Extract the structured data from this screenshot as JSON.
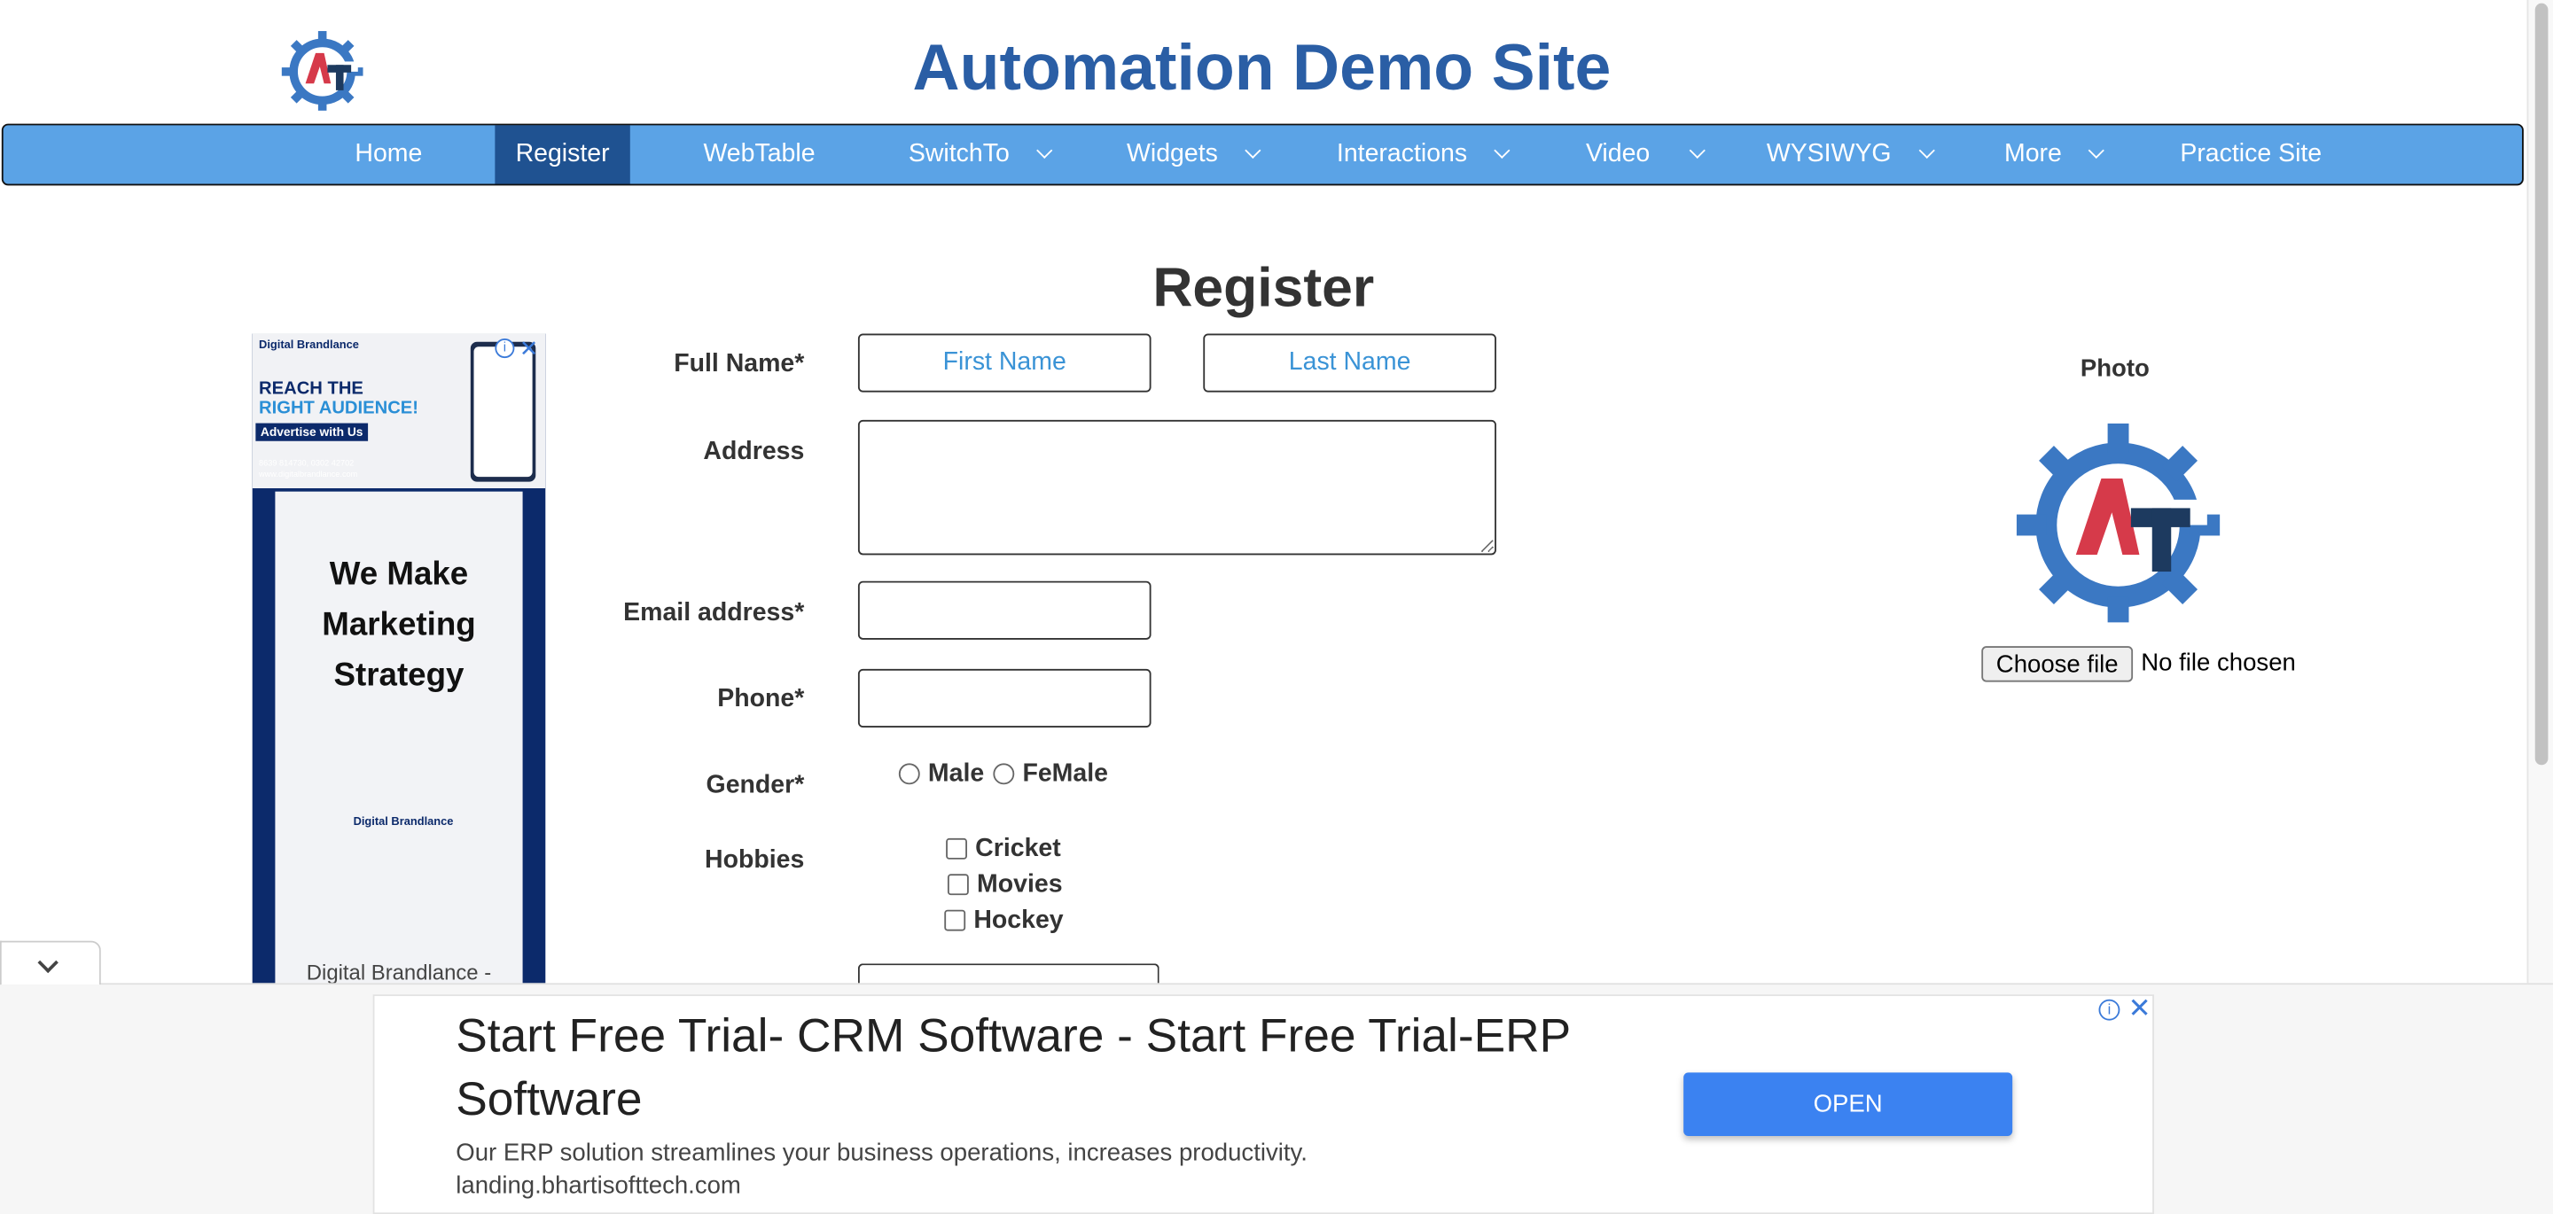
{
  "site": {
    "title": "Automation Demo Site"
  },
  "nav": {
    "items": [
      {
        "label": "Home"
      },
      {
        "label": "Register"
      },
      {
        "label": "WebTable"
      },
      {
        "label": "SwitchTo"
      },
      {
        "label": "Widgets"
      },
      {
        "label": "Interactions"
      },
      {
        "label": "Video"
      },
      {
        "label": "WYSIWYG"
      },
      {
        "label": "More"
      },
      {
        "label": "Practice Site"
      }
    ],
    "active": "Register",
    "colors": {
      "bar": "#5ba3e6",
      "active": "#1f5291"
    }
  },
  "form": {
    "heading": "Register",
    "full_name_label": "Full Name*",
    "first_name_placeholder": "First Name",
    "last_name_placeholder": "Last Name",
    "address_label": "Address",
    "email_label": "Email address*",
    "phone_label": "Phone*",
    "gender_label": "Gender*",
    "gender_options": [
      "Male",
      "FeMale"
    ],
    "hobbies_label": "Hobbies",
    "hobbies_options": [
      "Cricket",
      "Movies",
      "Hockey"
    ]
  },
  "photo": {
    "label": "Photo",
    "choose_file_label": "Choose file",
    "no_file_text": "No file chosen"
  },
  "side_ad": {
    "brand_top": "Digital Brandlance",
    "reach_line1": "REACH THE",
    "reach_line2": "RIGHT AUDIENCE!",
    "advertise": "Advertise with Us",
    "phones": "8639 814730, 0302 42702",
    "website": "www.digitalbrandlance.com",
    "headline": "We Make Marketing Strategy",
    "brand_mid": "Digital Brandlance",
    "footer": "Digital Brandlance -"
  },
  "bottom_ad": {
    "title": "Start Free Trial- CRM Software - Start Free Trial-ERP Software",
    "description": "Our ERP solution streamlines your business operations, increases productivity.",
    "url": "landing.bhartisofttech.com",
    "button": "OPEN"
  },
  "icons": [
    "gear-logo-icon",
    "chevron-down-icon",
    "info-icon",
    "close-icon"
  ],
  "colors": {
    "title": "#2a5ea5",
    "ad_button": "#3b82f1",
    "ad_navy": "#0c2a6b"
  }
}
